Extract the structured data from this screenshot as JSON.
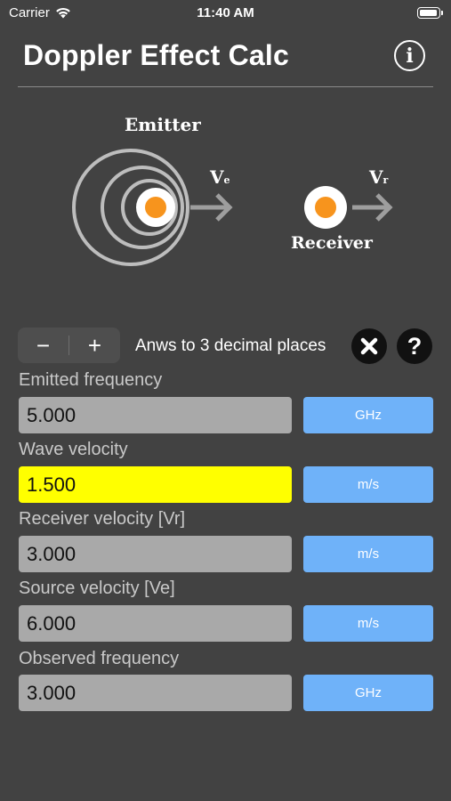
{
  "status_bar": {
    "carrier": "Carrier",
    "time": "11:40 AM"
  },
  "header": {
    "title": "Doppler Effect Calc",
    "info_icon": "info-icon"
  },
  "diagram": {
    "emitter_label": "Emitter",
    "receiver_label": "Receiver",
    "ve_label": "V",
    "ve_sub": "e",
    "vr_label": "V",
    "vr_sub": "r",
    "colors": {
      "dot": "#f7941d",
      "rings": "#bdbdbd",
      "arrow": "#9e9e9e"
    }
  },
  "controls": {
    "minus_label": "−",
    "plus_label": "+",
    "decimal_text": "Anws to 3 decimal places",
    "clear_icon": "close-icon",
    "help_icon": "question-icon"
  },
  "fields": [
    {
      "label": "Emitted frequency",
      "value": "5.000",
      "unit": "GHz",
      "active": false
    },
    {
      "label": "Wave velocity",
      "value": "1.500",
      "unit": "m/s",
      "active": true
    },
    {
      "label": "Receiver velocity [Vr]",
      "value": "3.000",
      "unit": "m/s",
      "active": false
    },
    {
      "label": "Source velocity [Ve]",
      "value": "6.000",
      "unit": "m/s",
      "active": false
    },
    {
      "label": "Observed frequency",
      "value": "3.000",
      "unit": "GHz",
      "active": false
    }
  ],
  "theme": {
    "background": "#424242",
    "field_bg": "#a9a9a9",
    "active_field_bg": "#ffff00",
    "unit_button_bg": "#6fb2f9"
  }
}
